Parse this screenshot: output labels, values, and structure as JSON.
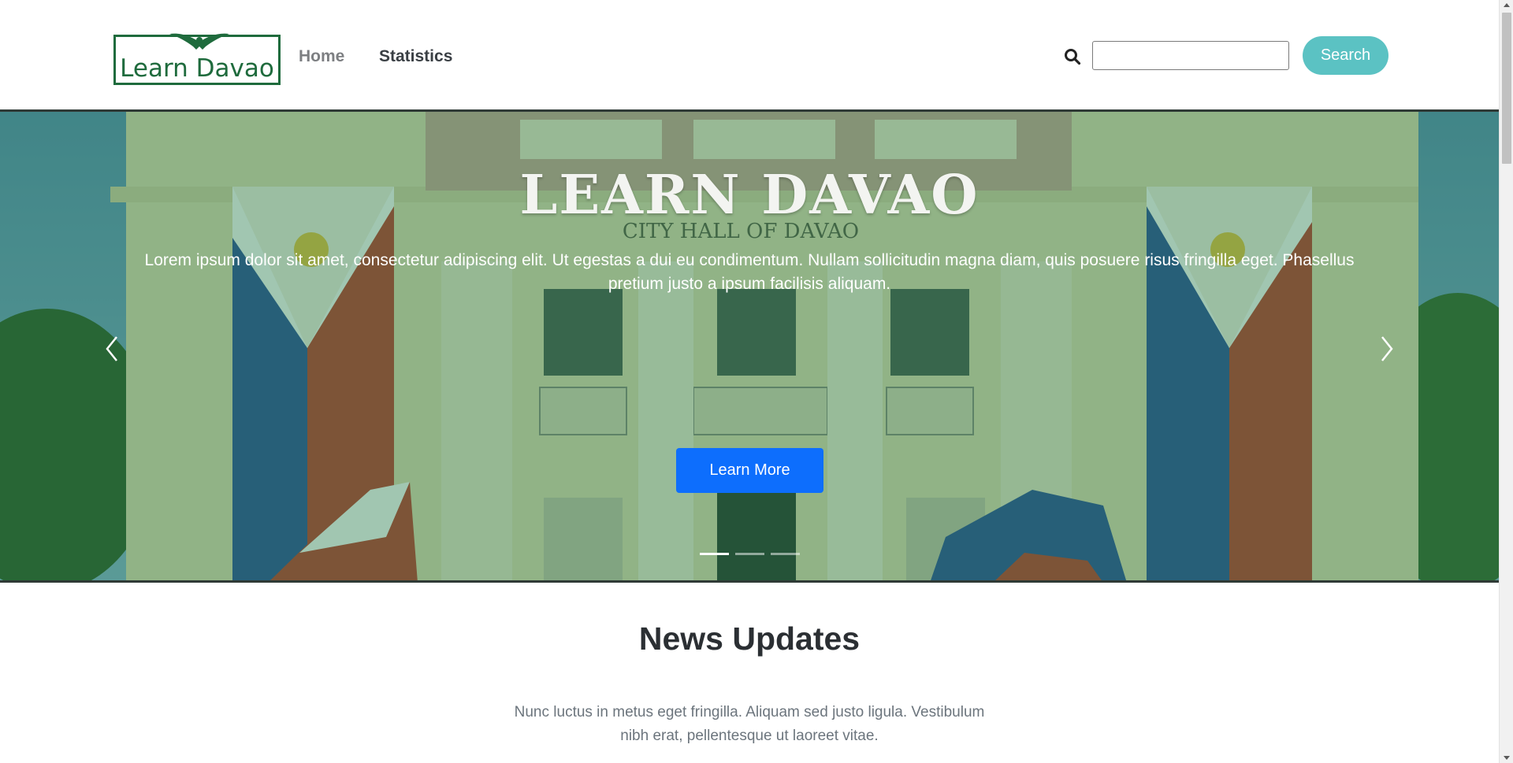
{
  "header": {
    "logo_text": "Learn Davao",
    "nav": [
      {
        "label": "Home"
      },
      {
        "label": "Statistics"
      }
    ],
    "search": {
      "value": "",
      "placeholder": "",
      "button_label": "Search"
    }
  },
  "hero": {
    "title": "LEARN DAVAO",
    "text": "Lorem ipsum dolor sit amet, consectetur adipiscing elit. Ut egestas a dui eu condimentum. Nullam sollicitudin magna diam, quis posuere risus fringilla eget. Phasellus pretium justo a ipsum facilisis aliquam.",
    "button_label": "Learn More",
    "background_sign": "CITY HALL OF DAVAO",
    "slides": 3,
    "active_slide": 1
  },
  "news": {
    "title": "News Updates",
    "text": "Nunc luctus in metus eget fringilla. Aliquam sed justo ligula. Vestibulum nibh erat, pellentesque ut laoreet vitae."
  },
  "colors": {
    "brand_green": "#1f6b3d",
    "search_button": "#5bc2c3",
    "primary_button": "#0d6efd",
    "hero_overlay": "#1e7846"
  },
  "icons": [
    "search-icon",
    "chevron-left-icon",
    "chevron-right-icon",
    "eagle-icon"
  ]
}
